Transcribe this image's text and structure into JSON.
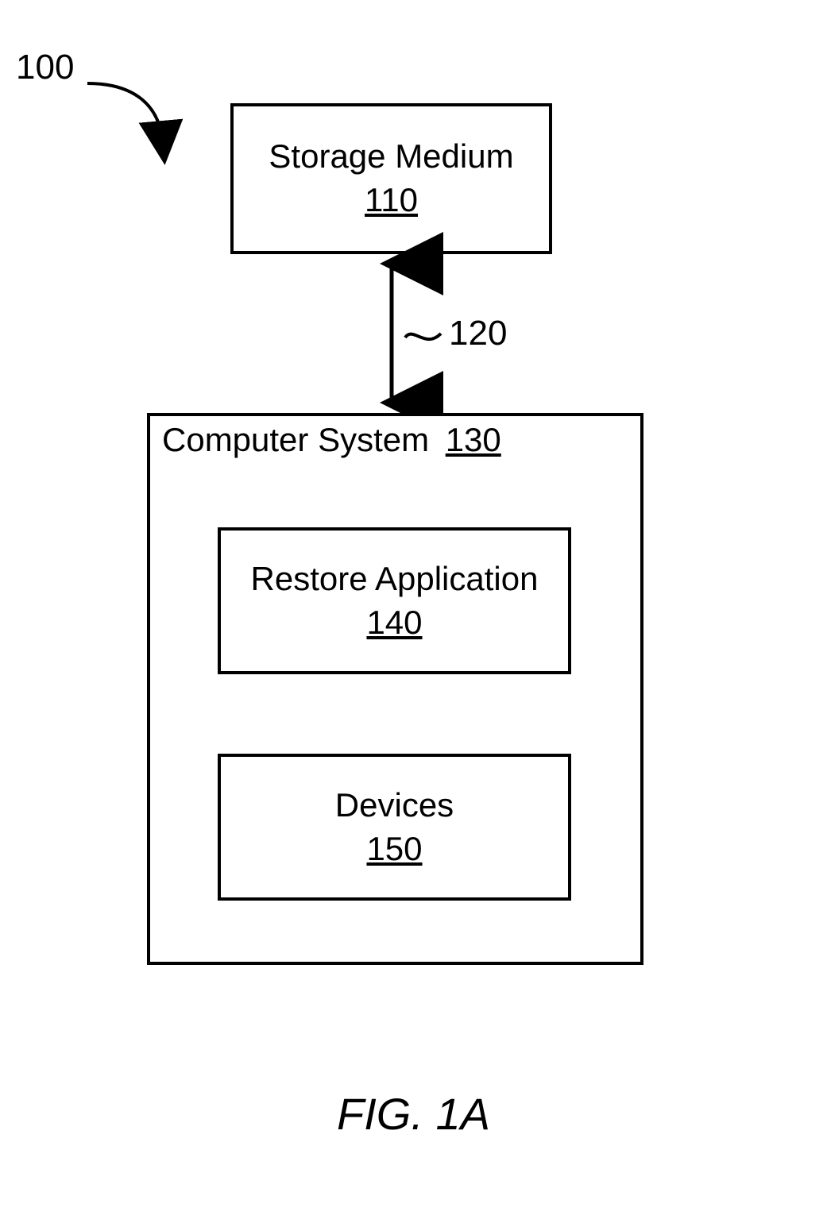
{
  "system_ref": "100",
  "storage": {
    "title": "Storage Medium",
    "num": "110"
  },
  "connector_ref": "120",
  "computer": {
    "title": "Computer System",
    "num": "130",
    "restore": {
      "title": "Restore Application",
      "num": "140"
    },
    "devices": {
      "title": "Devices",
      "num": "150"
    }
  },
  "figure_label": "FIG. 1A"
}
